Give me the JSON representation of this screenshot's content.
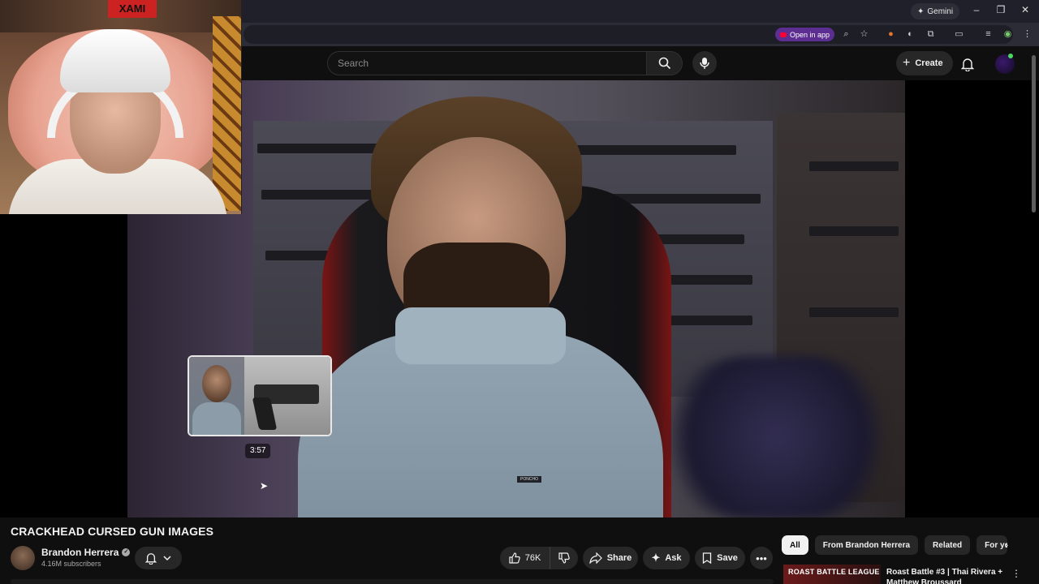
{
  "browser": {
    "gemini_label": "Gemini",
    "open_in_app_label": "Open in app",
    "window_controls": [
      "–",
      "❐",
      "✕"
    ]
  },
  "header": {
    "search_placeholder": "Search",
    "create_label": "Create"
  },
  "webcam": {
    "sign_text": "XAMI"
  },
  "player": {
    "preview_time": "3:57",
    "shirt_label": "PONCHO"
  },
  "video": {
    "title": "CRACKHEAD CURSED GUN IMAGES",
    "channel_name": "Brandon Herrera",
    "subscribers": "4.16M subscribers",
    "likes": "76K",
    "share_label": "Share",
    "ask_label": "Ask",
    "save_label": "Save"
  },
  "sidebar": {
    "chips": [
      "All",
      "From Brandon Herrera",
      "Related",
      "For yo"
    ],
    "reco": {
      "thumb_text": "ROAST BATTLE LEAGUE",
      "title": "Roast Battle #3 | Thai Rivera + Matthew Broussard"
    }
  },
  "colors": {
    "background": "#0f0f0f",
    "chip_active": "#f1f1f1",
    "open_app": "#5c2e91",
    "youtube_red": "#ff0033"
  }
}
